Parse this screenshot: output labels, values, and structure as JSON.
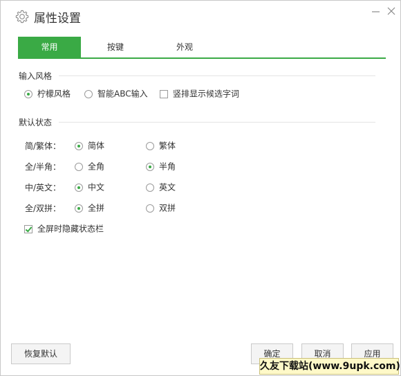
{
  "window": {
    "title": "属性设置"
  },
  "tabs": [
    {
      "label": "常用",
      "active": true
    },
    {
      "label": "按键",
      "active": false
    },
    {
      "label": "外观",
      "active": false
    }
  ],
  "input_style": {
    "title": "输入风格",
    "options": [
      {
        "label": "柠檬风格",
        "type": "radio",
        "checked": true
      },
      {
        "label": "智能ABC输入",
        "type": "radio",
        "checked": false
      },
      {
        "label": "竖排显示候选字词",
        "type": "checkbox",
        "checked": false
      }
    ]
  },
  "default_state": {
    "title": "默认状态",
    "rows": [
      {
        "label": "简/繁体：",
        "options": [
          {
            "label": "简体",
            "checked": true
          },
          {
            "label": "繁体",
            "checked": false
          }
        ]
      },
      {
        "label": "全/半角：",
        "options": [
          {
            "label": "全角",
            "checked": false
          },
          {
            "label": "半角",
            "checked": true
          }
        ]
      },
      {
        "label": "中/英文：",
        "options": [
          {
            "label": "中文",
            "checked": true
          },
          {
            "label": "英文",
            "checked": false
          }
        ]
      },
      {
        "label": "全/双拼：",
        "options": [
          {
            "label": "全拼",
            "checked": true
          },
          {
            "label": "双拼",
            "checked": false
          }
        ]
      }
    ],
    "fullscreen_hide": {
      "label": "全屏时隐藏状态栏",
      "checked": true
    }
  },
  "buttons": {
    "reset": "恢复默认",
    "ok": "确定",
    "cancel": "取消",
    "apply": "应用"
  },
  "watermark": "久友下载站(www.9upk.com)",
  "colors": {
    "accent": "#3aaa45"
  }
}
